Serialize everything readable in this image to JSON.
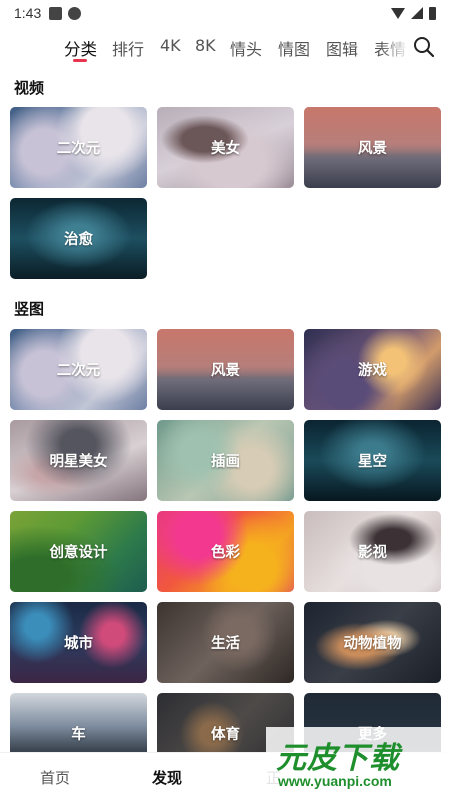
{
  "status_bar": {
    "time": "1:43"
  },
  "tabs": [
    {
      "label": "分类",
      "active": true
    },
    {
      "label": "排行"
    },
    {
      "label": "4K"
    },
    {
      "label": "8K"
    },
    {
      "label": "情头"
    },
    {
      "label": "情图"
    },
    {
      "label": "图辑"
    },
    {
      "label": "表情"
    }
  ],
  "sections": {
    "video": {
      "title": "视频",
      "items": [
        "二次元",
        "美女",
        "风景",
        "治愈"
      ]
    },
    "vertical": {
      "title": "竖图",
      "items": [
        "二次元",
        "风景",
        "游戏",
        "明星美女",
        "插画",
        "星空",
        "创意设计",
        "色彩",
        "影视",
        "城市",
        "生活",
        "动物植物",
        "车",
        "体育",
        "更多"
      ]
    }
  },
  "bottom_nav": [
    {
      "label": "首页"
    },
    {
      "label": "发现",
      "active": true
    },
    {
      "label": "正"
    }
  ],
  "watermark": {
    "logo": "元皮下载",
    "url": "www.yuanpi.com"
  },
  "colors": {
    "accent": "#e8344e",
    "watermark_green": "#1f8f2d"
  }
}
